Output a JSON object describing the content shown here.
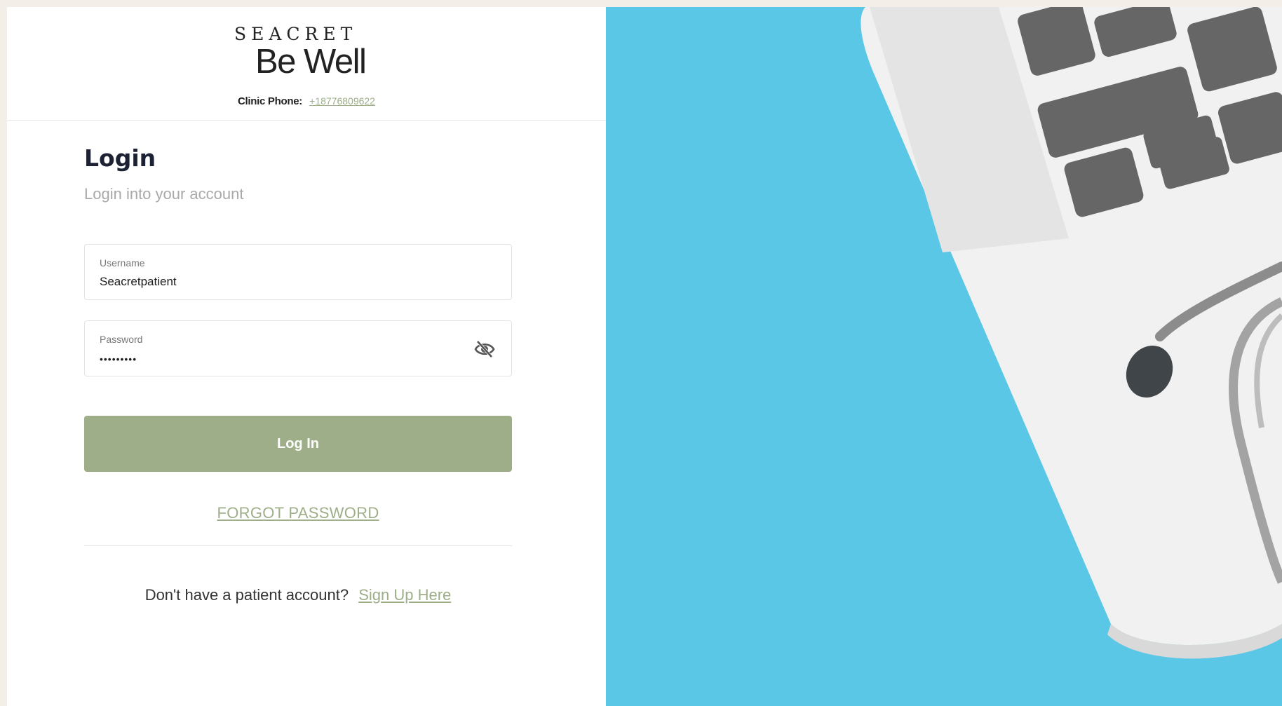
{
  "brand": {
    "logo_top": "SEACRET",
    "logo_bottom": "Be Well"
  },
  "header": {
    "phone_label": "Clinic Phone:",
    "phone_number": "+18776809622"
  },
  "login": {
    "title": "Login",
    "subtitle": "Login into your account",
    "username_label": "Username",
    "username_value": "Seacretpatient",
    "password_label": "Password",
    "password_value": "•••••••••",
    "submit_label": "Log In",
    "forgot_label": "FORGOT PASSWORD",
    "signup_prompt": "Don't have a patient account?",
    "signup_link": "Sign Up Here"
  },
  "icons": {
    "password_toggle": "eye-off-icon"
  },
  "colors": {
    "accent": "#9dae88",
    "photo_background": "#5bc7e6",
    "page_background": "#f3eee8"
  }
}
